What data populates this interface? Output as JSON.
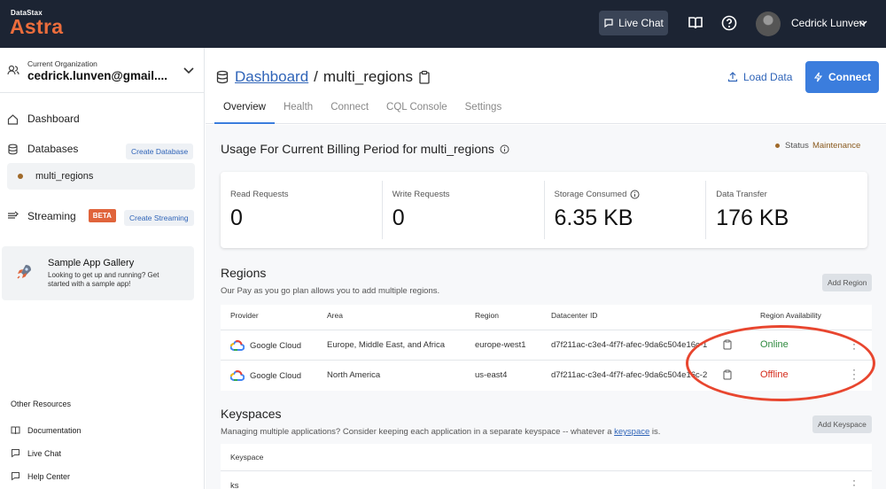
{
  "topbar": {
    "brand_small": "DataStax",
    "brand_big": "Astra",
    "live_chat": "Live Chat",
    "user_name": "Cedrick Lunven"
  },
  "sidebar": {
    "org_label": "Current Organization",
    "org_email": "cedrick.lunven@gmail....",
    "dashboard": "Dashboard",
    "databases": "Databases",
    "create_database": "Create Database",
    "db_item": "multi_regions",
    "streaming": "Streaming",
    "beta": "BETA",
    "create_streaming": "Create Streaming",
    "gallery_title": "Sample App Gallery",
    "gallery_sub": "Looking to get up and running? Get started with a sample app!",
    "other_resources": "Other Resources",
    "documentation": "Documentation",
    "live_chat": "Live Chat",
    "help_center": "Help Center"
  },
  "header": {
    "breadcrumb_link": "Dashboard",
    "breadcrumb_sep": "/",
    "db_name": "multi_regions",
    "load_data": "Load Data",
    "connect": "Connect",
    "tabs": [
      "Overview",
      "Health",
      "Connect",
      "CQL Console",
      "Settings"
    ]
  },
  "usage": {
    "title": "Usage For Current Billing Period for multi_regions",
    "status_label": "Status",
    "status_value": "Maintenance",
    "metrics": [
      {
        "label": "Read Requests",
        "value": "0"
      },
      {
        "label": "Write Requests",
        "value": "0"
      },
      {
        "label": "Storage Consumed",
        "value": "6.35 KB"
      },
      {
        "label": "Data Transfer",
        "value": "176 KB"
      }
    ]
  },
  "regions": {
    "title": "Regions",
    "desc": "Our Pay as you go plan allows you to add multiple regions.",
    "add_button": "Add Region",
    "headers": [
      "Provider",
      "Area",
      "Region",
      "Datacenter ID",
      "Region Availability"
    ],
    "rows": [
      {
        "provider": "Google Cloud",
        "area": "Europe, Middle East, and Africa",
        "region": "europe-west1",
        "dc": "d7f211ac-c3e4-4f7f-afec-9da6c504e16c-1",
        "availability": "Online"
      },
      {
        "provider": "Google Cloud",
        "area": "North America",
        "region": "us-east4",
        "dc": "d7f211ac-c3e4-4f7f-afec-9da6c504e16c-2",
        "availability": "Offline"
      }
    ]
  },
  "keyspaces": {
    "title": "Keyspaces",
    "desc_prefix": "Managing multiple applications? Consider keeping each application in a separate keyspace -- whatever a ",
    "desc_link": "keyspace",
    "desc_suffix": " is.",
    "add_button": "Add Keyspace",
    "header": "Keyspace",
    "rows": [
      "ks"
    ]
  },
  "colors": {
    "topbar_bg": "#1c2433",
    "brand": "#ec6d3c",
    "accent": "#3b7ddd",
    "online": "#2e8a3e",
    "offline": "#d42a1a",
    "annotation": "#e8462f"
  }
}
